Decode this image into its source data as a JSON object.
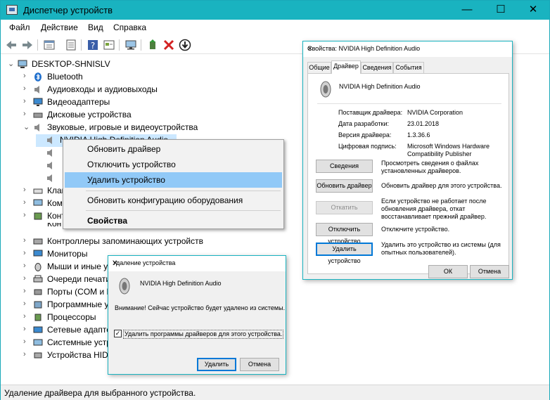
{
  "window": {
    "title": "Диспетчер устройств",
    "controls": {
      "minimize": "—",
      "maximize": "☐",
      "close": "✕"
    }
  },
  "menu": [
    "Файл",
    "Действие",
    "Вид",
    "Справка"
  ],
  "tree": {
    "root": "DESKTOP-SHNISLV",
    "items": [
      {
        "label": "Bluetooth"
      },
      {
        "label": "Аудиовходы и аудиовыходы"
      },
      {
        "label": "Видеоадаптеры"
      },
      {
        "label": "Дисковые устройства"
      },
      {
        "label": "Звуковые, игровые и видеоустройства"
      },
      {
        "label": "NVIDIA High Definition Audio"
      },
      {
        "label": "Клав"
      },
      {
        "label": "Комп"
      },
      {
        "label": "Конт"
      },
      {
        "label": "Контроллеры USB"
      },
      {
        "label": "Контроллеры запоминающих устройств"
      },
      {
        "label": "Мониторы"
      },
      {
        "label": "Мыши и иные у"
      },
      {
        "label": "Очереди печати"
      },
      {
        "label": "Порты (COM и L"
      },
      {
        "label": "Программные у"
      },
      {
        "label": "Процессоры"
      },
      {
        "label": "Сетевые адаптер"
      },
      {
        "label": "Системные устр"
      },
      {
        "label": "Устройства HID"
      }
    ]
  },
  "context_menu": {
    "items": [
      "Обновить драйвер",
      "Отключить устройство",
      "Удалить устройство",
      "Обновить конфигурацию оборудования",
      "Свойства"
    ]
  },
  "properties": {
    "title": "Свойства: NVIDIA High Definition Audio",
    "tabs": [
      "Общие",
      "Драйвер",
      "Сведения",
      "События"
    ],
    "device": "NVIDIA High Definition Audio",
    "fields": [
      {
        "label": "Поставщик драйвера:",
        "value": "NVIDIA Corporation"
      },
      {
        "label": "Дата разработки:",
        "value": "23.01.2018"
      },
      {
        "label": "Версия драйвера:",
        "value": "1.3.36.6"
      },
      {
        "label": "Цифровая подпись:",
        "value": "Microsoft Windows Hardware Compatibility Publisher"
      }
    ],
    "actions": [
      {
        "button": "Сведения",
        "desc": "Просмотреть сведения о файлах установленных драйверов."
      },
      {
        "button": "Обновить драйвер",
        "desc": "Обновить драйвер для этого устройства."
      },
      {
        "button": "Откатить",
        "desc": "Если устройство не работает после обновления драйвера, откат восстанавливает прежний драйвер."
      },
      {
        "button": "Отключить устройство",
        "desc": "Отключите устройство."
      },
      {
        "button": "Удалить устройство",
        "desc": "Удалить это устройство из системы (для опытных пользователей)."
      }
    ],
    "ok": "ОК",
    "cancel": "Отмена"
  },
  "uninstall": {
    "title": "Удаление устройства",
    "device": "NVIDIA High Definition Audio",
    "warning": "Внимание! Сейчас устройство будет удалено из системы.",
    "checkbox": "Удалить программы драйверов для этого устройства.",
    "checked": true,
    "ok": "Удалить",
    "cancel": "Отмена"
  },
  "status": "Удаление драйвера для выбранного устройства.",
  "colors": {
    "titlebar": "#19b3c0",
    "highlight": "#91c9f7",
    "accent": "#0078d7"
  },
  "icons": [
    "back-arrow-icon",
    "forward-arrow-icon",
    "computer-icon",
    "speaker-icon",
    "bluetooth-icon",
    "remove-x-icon",
    "download-arrow-icon"
  ]
}
